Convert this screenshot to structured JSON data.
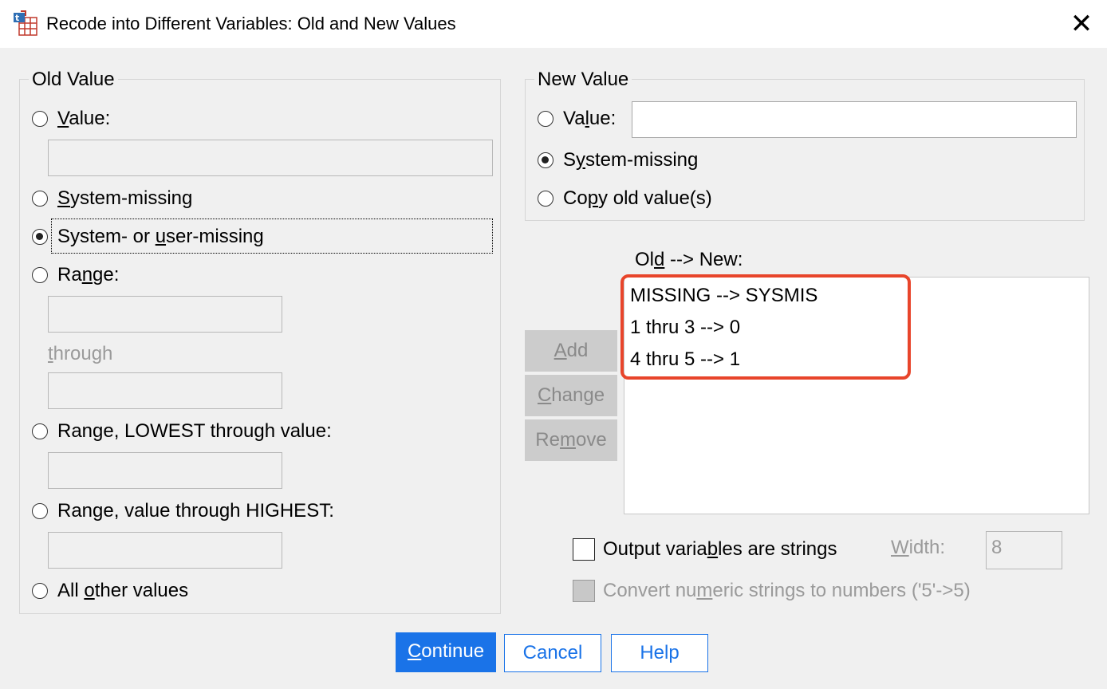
{
  "window": {
    "title": "Recode into Different Variables: Old and New Values",
    "close_glyph": "✕"
  },
  "old_value": {
    "legend": "Old Value",
    "value_label_pre": "",
    "value_label_u": "V",
    "value_label_post": "alue:",
    "value_input": "",
    "system_missing_u": "S",
    "system_missing_post": "ystem-missing",
    "sys_user_pre": "System- or ",
    "sys_user_u": "u",
    "sys_user_post": "ser-missing",
    "range_pre": "Ra",
    "range_u": "n",
    "range_post": "ge:",
    "range_from": "",
    "through_u": "t",
    "through_post": "hrough",
    "range_to": "",
    "lowest_pre": "Range, LOWEST through value:",
    "lowest_input": "",
    "highest_pre": "Ran",
    "highest_u": "g",
    "highest_post": "e, value through HIGHEST:",
    "highest_input": "",
    "all_other_pre": "All ",
    "all_other_u": "o",
    "all_other_post": "ther values",
    "selected": "system_or_user_missing"
  },
  "new_value": {
    "legend": "New Value",
    "value_pre": "Va",
    "value_u": "l",
    "value_post": "ue:",
    "value_input": "",
    "sysmis_pre": "S",
    "sysmis_u": "y",
    "sysmis_post": "stem-missing",
    "copy_pre": "Co",
    "copy_u": "p",
    "copy_post": "y old value(s)",
    "selected": "system_missing"
  },
  "mapping": {
    "label_pre": "Ol",
    "label_u": "d",
    "label_post": " --> New:",
    "items": [
      "MISSING --> SYSMIS",
      "1 thru 3 --> 0",
      "4 thru 5 --> 1"
    ],
    "highlight_color": "#e8452b"
  },
  "buttons": {
    "add_u": "A",
    "add_post": "dd",
    "change_u": "C",
    "change_post": "hange",
    "remove_pre": "Re",
    "remove_u": "m",
    "remove_post": "ove",
    "continue_u": "C",
    "continue_post": "ontinue",
    "cancel": "Cancel",
    "help": "Help"
  },
  "options": {
    "output_strings_pre": "Output varia",
    "output_strings_u": "b",
    "output_strings_post": "les are strings",
    "output_strings_checked": false,
    "width_u": "W",
    "width_post": "idth:",
    "width_value": "8",
    "convert_pre": "Convert nu",
    "convert_u": "m",
    "convert_post": "eric strings to numbers ('5'->5)",
    "convert_checked": false
  },
  "colors": {
    "accent": "#1a73e8",
    "highlight": "#e8452b",
    "dialog_bg": "#f0f0f0"
  }
}
